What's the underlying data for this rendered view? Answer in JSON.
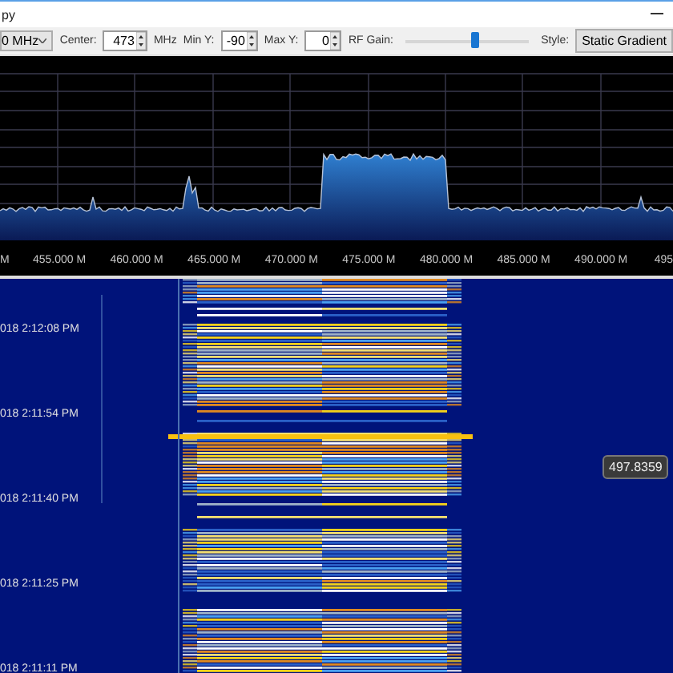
{
  "window": {
    "title": "py"
  },
  "toolbar": {
    "span": {
      "value": "0 MHz"
    },
    "center": {
      "label": "Center:",
      "value": "473",
      "unit": "MHz"
    },
    "min_y": {
      "label": "Min Y:",
      "value": "-90"
    },
    "max_y": {
      "label": "Max Y:",
      "value": "0"
    },
    "rf_gain": {
      "label": "RF Gain:",
      "level": 0.56
    },
    "style": {
      "label": "Style:",
      "value": "Static Gradient"
    }
  },
  "spectrum": {
    "axis_labels": [
      "M",
      "455.000 M",
      "460.000 M",
      "465.000 M",
      "470.000 M",
      "475.000 M",
      "480.000 M",
      "485.000 M",
      "490.000 M",
      "495"
    ]
  },
  "waterfall": {
    "timestamps": [
      "018 2:12:08 PM",
      "018 2:11:54 PM",
      "018 2:11:40 PM",
      "018 2:11:25 PM",
      "018 2:11:11 PM"
    ],
    "tooltip": "497.8359"
  }
}
